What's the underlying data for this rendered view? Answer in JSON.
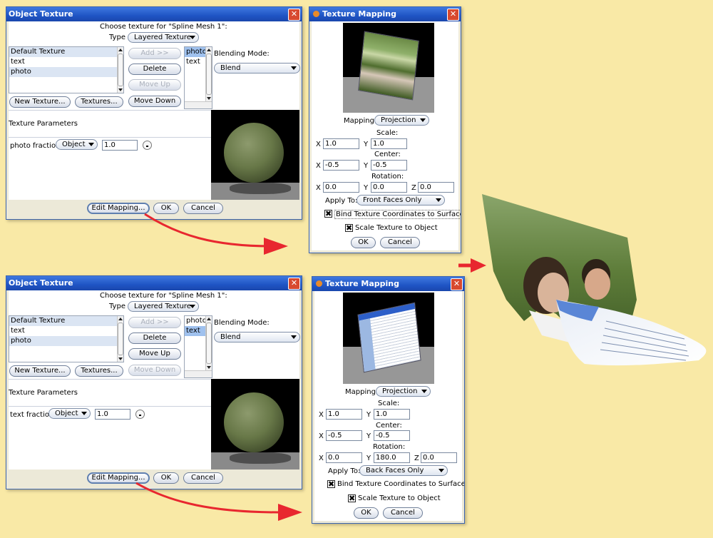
{
  "colors": {
    "background": "#f9e9a6",
    "titlebar": "#2359cc",
    "arrow": "#e8272f"
  },
  "obj_top": {
    "title": "Object Texture",
    "choose_text": "Choose texture for \"Spline Mesh 1\":",
    "type_label": "Type",
    "type_value": "Layered Texture",
    "textures": [
      "Default Texture",
      "text",
      "photo"
    ],
    "buttons": {
      "add": "Add >>",
      "delete": "Delete",
      "move_up": "Move Up",
      "move_down": "Move Down",
      "new_texture": "New Texture...",
      "textures": "Textures..."
    },
    "layers": [
      "photo",
      "text"
    ],
    "blending_label": "Blending Mode:",
    "blending_value": "Blend",
    "tex_params_label": "Texture Parameters",
    "fraction_label": "photo fraction",
    "fraction_type": "Object",
    "fraction_value": "1.0",
    "footer": {
      "edit_mapping": "Edit Mapping...",
      "ok": "OK",
      "cancel": "Cancel"
    }
  },
  "obj_bottom": {
    "title": "Object Texture",
    "choose_text": "Choose texture for \"Spline Mesh 1\":",
    "type_label": "Type",
    "type_value": "Layered Texture",
    "textures": [
      "Default Texture",
      "text",
      "photo"
    ],
    "buttons": {
      "add": "Add >>",
      "delete": "Delete",
      "move_up": "Move Up",
      "move_down": "Move Down",
      "new_texture": "New Texture...",
      "textures": "Textures..."
    },
    "layers": [
      "photo",
      "text"
    ],
    "blending_label": "Blending Mode:",
    "blending_value": "Blend",
    "tex_params_label": "Texture Parameters",
    "fraction_label": "text fraction",
    "fraction_type": "Object",
    "fraction_value": "1.0",
    "footer": {
      "edit_mapping": "Edit Mapping...",
      "ok": "OK",
      "cancel": "Cancel"
    }
  },
  "map_top": {
    "title": "Texture Mapping",
    "mapping_label": "Mapping:",
    "mapping_value": "Projection",
    "scale_label": "Scale:",
    "scale": {
      "x_label": "X",
      "x": "1.0",
      "y_label": "Y",
      "y": "1.0"
    },
    "center_label": "Center:",
    "center": {
      "x_label": "X",
      "x": "-0.5",
      "y_label": "Y",
      "y": "-0.5"
    },
    "rotation_label": "Rotation:",
    "rotation": {
      "x_label": "X",
      "x": "0.0",
      "y_label": "Y",
      "y": "0.0",
      "z_label": "Z",
      "z": "0.0"
    },
    "apply_label": "Apply To:",
    "apply_value": "Front Faces Only",
    "bind_label": "Bind Texture Coordinates to Surface",
    "bind_checked": true,
    "scale_obj_label": "Scale Texture to Object",
    "scale_obj_checked": true,
    "ok": "OK",
    "cancel": "Cancel"
  },
  "map_bottom": {
    "title": "Texture Mapping",
    "mapping_label": "Mapping:",
    "mapping_value": "Projection",
    "scale_label": "Scale:",
    "scale": {
      "x_label": "X",
      "x": "1.0",
      "y_label": "Y",
      "y": "1.0"
    },
    "center_label": "Center:",
    "center": {
      "x_label": "X",
      "x": "-0.5",
      "y_label": "Y",
      "y": "-0.5"
    },
    "rotation_label": "Rotation:",
    "rotation": {
      "x_label": "X",
      "x": "0.0",
      "y_label": "Y",
      "y": "180.0",
      "z_label": "Z",
      "z": "0.0"
    },
    "apply_label": "Apply To:",
    "apply_value": "Back Faces Only",
    "bind_label": "Bind Texture Coordinates to Surface",
    "bind_checked": true,
    "scale_obj_label": "Scale Texture to Object",
    "scale_obj_checked": true,
    "ok": "OK",
    "cancel": "Cancel"
  },
  "check_glyph": "✖",
  "close_glyph": "✕"
}
